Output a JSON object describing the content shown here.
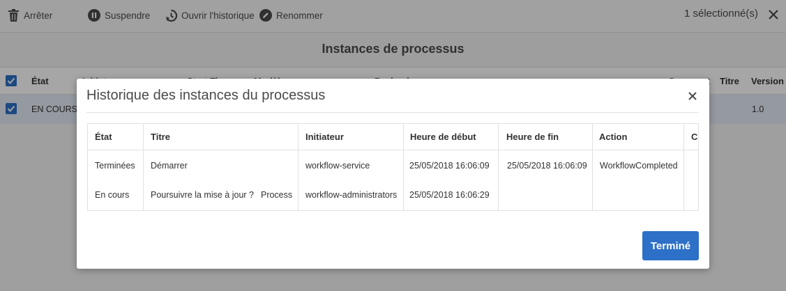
{
  "toolbar": {
    "stop_label": "Arrêter",
    "suspend_label": "Suspendre",
    "history_label": "Ouvrir l'historique",
    "rename_label": "Renommer",
    "selection_count": "1 sélectionné(s)"
  },
  "page": {
    "title": "Instances de processus"
  },
  "background_table": {
    "headers": [
      "État",
      "Initiateur",
      "Start Time",
      "Modèle",
      "Payload",
      "Comment",
      "Titre",
      "Version"
    ],
    "row": {
      "state": "EN COURS",
      "version": "1.0"
    }
  },
  "dialog": {
    "title": "Historique des instances du processus",
    "columns": [
      "État",
      "Titre",
      "Initiateur",
      "Heure de début",
      "Heure de fin",
      "Action",
      "Co"
    ],
    "rows": [
      {
        "state": "Terminées",
        "title": "Démarrer",
        "tag": "",
        "initiator": "workflow-service",
        "start": "25/05/2018 16:06:09",
        "end": "25/05/2018 16:06:09",
        "action": "WorkflowCompleted"
      },
      {
        "state": "En cours",
        "title": "Poursuivre la mise à jour ?",
        "tag": "Process",
        "initiator": "workflow-administrators",
        "start": "25/05/2018 16:06:29",
        "end": "",
        "action": ""
      }
    ],
    "done_label": "Terminé"
  },
  "colors": {
    "accent": "#2d70c7",
    "selected_row": "#e5ecf6",
    "overlay": "rgba(0,0,0,0.35)"
  }
}
